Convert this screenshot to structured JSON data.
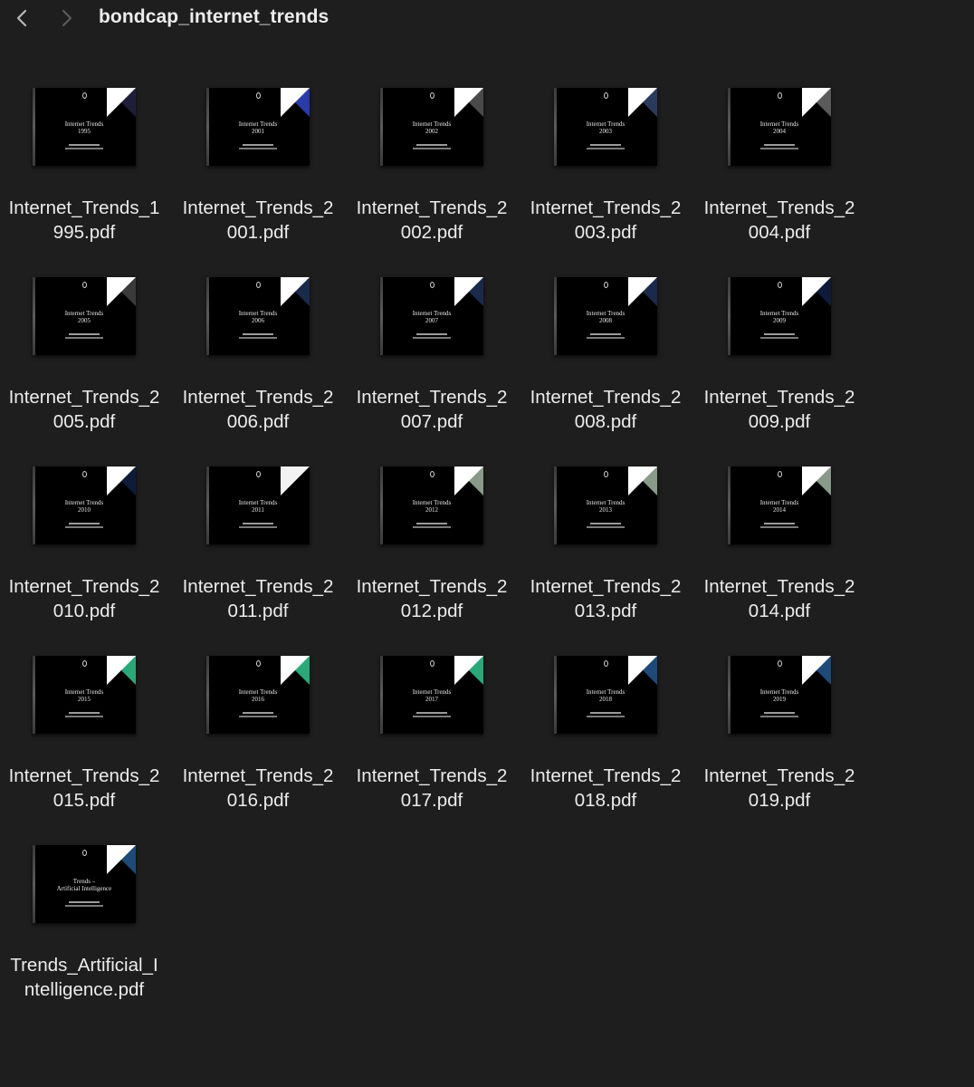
{
  "window": {
    "title": "bondcap_internet_trends"
  },
  "toolbar": {
    "back_icon": "chevron-left-icon",
    "forward_icon": "chevron-right-icon"
  },
  "files": [
    {
      "name_line1": "Internet_Trends_1",
      "name_line2": "995.pdf",
      "thumb_title": "Internet Trends",
      "thumb_year": "1995",
      "corner_color": "#1e1e3a",
      "corner_page_color": "#ffffff"
    },
    {
      "name_line1": "Internet_Trends_2",
      "name_line2": "001.pdf",
      "thumb_title": "Internet Trends",
      "thumb_year": "2001",
      "corner_color": "#2a3aa8",
      "corner_page_color": "#ffffff"
    },
    {
      "name_line1": "Internet_Trends_2",
      "name_line2": "002.pdf",
      "thumb_title": "Internet Trends",
      "thumb_year": "2002",
      "corner_color": "#4a4a4a",
      "corner_page_color": "#ffffff"
    },
    {
      "name_line1": "Internet_Trends_2",
      "name_line2": "003.pdf",
      "thumb_title": "Internet Trends",
      "thumb_year": "2003",
      "corner_color": "#2a3a5a",
      "corner_page_color": "#ffffff"
    },
    {
      "name_line1": "Internet_Trends_2",
      "name_line2": "004.pdf",
      "thumb_title": "Internet Trends",
      "thumb_year": "2004",
      "corner_color": "#5a5a5a",
      "corner_page_color": "#ffffff"
    },
    {
      "name_line1": "Internet_Trends_2",
      "name_line2": "005.pdf",
      "thumb_title": "Internet Trends",
      "thumb_year": "2005",
      "corner_color": "#3a3a3a",
      "corner_page_color": "#ffffff"
    },
    {
      "name_line1": "Internet_Trends_2",
      "name_line2": "006.pdf",
      "thumb_title": "Internet Trends",
      "thumb_year": "2006",
      "corner_color": "#1a2a4a",
      "corner_page_color": "#ffffff"
    },
    {
      "name_line1": "Internet_Trends_2",
      "name_line2": "007.pdf",
      "thumb_title": "Internet Trends",
      "thumb_year": "2007",
      "corner_color": "#1a2a4a",
      "corner_page_color": "#ffffff"
    },
    {
      "name_line1": "Internet_Trends_2",
      "name_line2": "008.pdf",
      "thumb_title": "Internet Trends",
      "thumb_year": "2008",
      "corner_color": "#1a2a4a",
      "corner_page_color": "#ffffff"
    },
    {
      "name_line1": "Internet_Trends_2",
      "name_line2": "009.pdf",
      "thumb_title": "Internet Trends",
      "thumb_year": "2009",
      "corner_color": "#0e1c3a",
      "corner_page_color": "#ffffff"
    },
    {
      "name_line1": "Internet_Trends_2",
      "name_line2": "010.pdf",
      "thumb_title": "Internet Trends",
      "thumb_year": "2010",
      "corner_color": "#0e1c3a",
      "corner_page_color": "#ffffff"
    },
    {
      "name_line1": "Internet_Trends_2",
      "name_line2": "011.pdf",
      "thumb_title": "Internet Trends",
      "thumb_year": "2011",
      "corner_color": "#000000",
      "corner_page_color": "#f2f2f2"
    },
    {
      "name_line1": "Internet_Trends_2",
      "name_line2": "012.pdf",
      "thumb_title": "Internet Trends",
      "thumb_year": "2012",
      "corner_color": "#8a9a8a",
      "corner_page_color": "#ffffff"
    },
    {
      "name_line1": "Internet_Trends_2",
      "name_line2": "013.pdf",
      "thumb_title": "Internet Trends",
      "thumb_year": "2013",
      "corner_color": "#8a9a8a",
      "corner_page_color": "#ffffff"
    },
    {
      "name_line1": "Internet_Trends_2",
      "name_line2": "014.pdf",
      "thumb_title": "Internet Trends",
      "thumb_year": "2014",
      "corner_color": "#8a9a8a",
      "corner_page_color": "#ffffff"
    },
    {
      "name_line1": "Internet_Trends_2",
      "name_line2": "015.pdf",
      "thumb_title": "Internet Trends",
      "thumb_year": "2015",
      "corner_color": "#2aa878",
      "corner_page_color": "#ffffff"
    },
    {
      "name_line1": "Internet_Trends_2",
      "name_line2": "016.pdf",
      "thumb_title": "Internet Trends",
      "thumb_year": "2016",
      "corner_color": "#2aa878",
      "corner_page_color": "#ffffff"
    },
    {
      "name_line1": "Internet_Trends_2",
      "name_line2": "017.pdf",
      "thumb_title": "Internet Trends",
      "thumb_year": "2017",
      "corner_color": "#2aa878",
      "corner_page_color": "#ffffff"
    },
    {
      "name_line1": "Internet_Trends_2",
      "name_line2": "018.pdf",
      "thumb_title": "Internet Trends",
      "thumb_year": "2018",
      "corner_color": "#1e4a7a",
      "corner_page_color": "#ffffff"
    },
    {
      "name_line1": "Internet_Trends_2",
      "name_line2": "019.pdf",
      "thumb_title": "Internet Trends",
      "thumb_year": "2019",
      "corner_color": "#1e4a7a",
      "corner_page_color": "#ffffff"
    },
    {
      "name_line1": "Trends_Artificial_I",
      "name_line2": "ntelligence.pdf",
      "thumb_title": "Trends –",
      "thumb_year": "Artificial Intelligence",
      "corner_color": "#1e4a7a",
      "corner_page_color": "#ffffff"
    }
  ]
}
